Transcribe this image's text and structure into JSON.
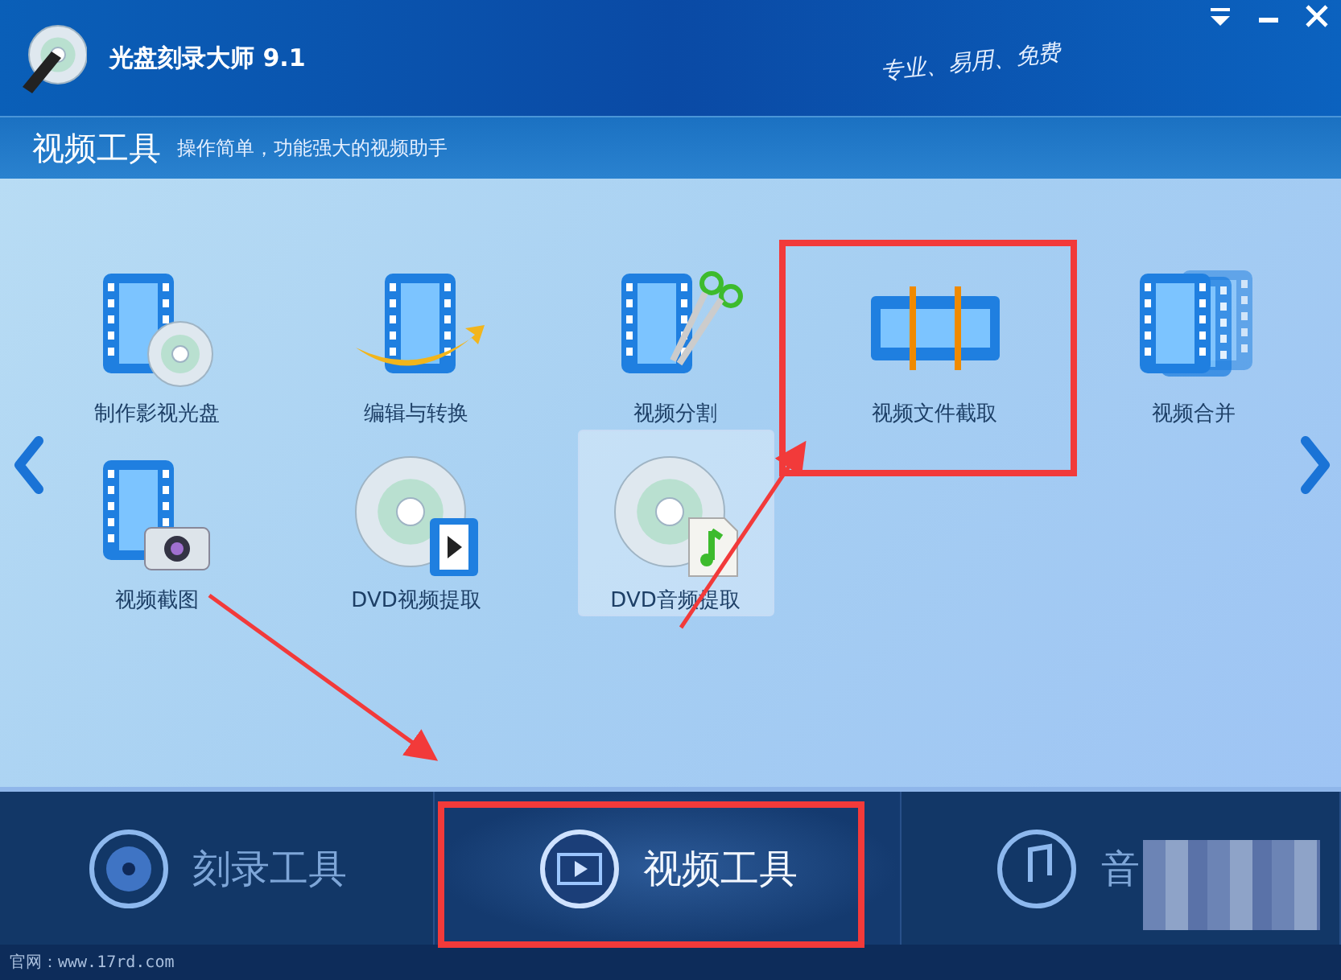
{
  "window": {
    "title": "光盘刻录大师 9.1",
    "slogan": "专业、易用、免费"
  },
  "header": {
    "title": "视频工具",
    "subtitle": "操作简单，功能强大的视频助手"
  },
  "tools": [
    {
      "label": "制作影视光盘",
      "kind": "film-disc",
      "selected": false
    },
    {
      "label": "编辑与转换",
      "kind": "film-swoosh",
      "selected": false
    },
    {
      "label": "视频分割",
      "kind": "film-scissors",
      "selected": false
    },
    {
      "label": "视频文件截取",
      "kind": "film-cut",
      "selected": false
    },
    {
      "label": "视频合并",
      "kind": "film-stack",
      "selected": false
    },
    {
      "label": "视频截图",
      "kind": "film-camera",
      "selected": false
    },
    {
      "label": "DVD视频提取",
      "kind": "dvd-video",
      "selected": false
    },
    {
      "label": "DVD音频提取",
      "kind": "dvd-audio",
      "selected": true
    }
  ],
  "bottom_tabs": [
    {
      "label": "刻录工具",
      "kind": "disc",
      "selected": false
    },
    {
      "label": "视频工具",
      "kind": "film",
      "selected": true
    },
    {
      "label": "音",
      "kind": "music",
      "selected": false
    }
  ],
  "status_bar": {
    "text": "官网：www.17rd.com"
  }
}
